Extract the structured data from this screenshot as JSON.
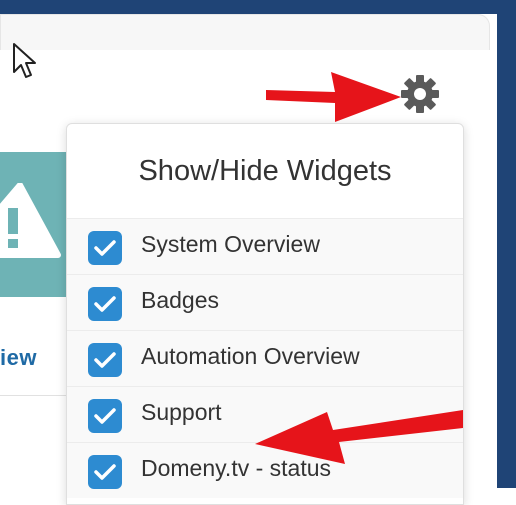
{
  "dropdown": {
    "title": "Show/Hide Widgets",
    "items": [
      {
        "label": "System Overview",
        "checked": true
      },
      {
        "label": "Badges",
        "checked": true
      },
      {
        "label": "Automation Overview",
        "checked": true
      },
      {
        "label": "Support",
        "checked": true
      },
      {
        "label": "Domeny.tv - status",
        "checked": true
      }
    ]
  },
  "widget": {
    "view_link": "iew"
  },
  "icons": {
    "settings": "gear-icon",
    "cursor": "cursor-icon",
    "warning": "warning-icon",
    "checkbox": "checkmark-icon"
  },
  "colors": {
    "header": "#1f4476",
    "checkbox": "#2d8bd1",
    "teal": "#6eb3b5",
    "arrow": "#e6141a",
    "link": "#1f6aa5"
  }
}
